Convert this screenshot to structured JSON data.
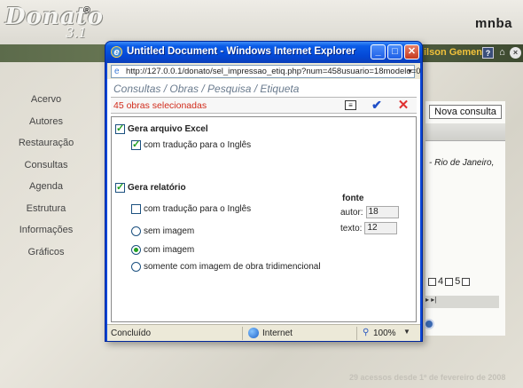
{
  "app": {
    "logo": "Donato",
    "logo_version": "3.1",
    "logo_reg": "®",
    "brand": "mnba",
    "user": "ilson Gemente",
    "footer": "29 acessos desde 1º de fevereiro de 2008"
  },
  "nav": {
    "items": [
      {
        "label": "Acervo"
      },
      {
        "label": "Autores"
      },
      {
        "label": "Restauração"
      },
      {
        "label": "Consultas"
      },
      {
        "label": "Agenda"
      },
      {
        "label": "Estrutura"
      },
      {
        "label": "Informações"
      },
      {
        "label": "Gráficos"
      }
    ]
  },
  "background_content": {
    "new_query_label": "Nova consulta",
    "partial_text": "- Rio de Janeiro,",
    "pager_4": "4",
    "pager_5": "5",
    "nav_arrows": "▸ ▸|"
  },
  "window": {
    "title": "Untitled Document - Windows Internet Explorer",
    "url": "http://127.0.0.1/donato/sel_impressao_etiq.php?num=458usuario=18modelo=0",
    "status": "Concluído",
    "zone": "Internet",
    "zoom": "100%"
  },
  "form": {
    "title": "Consultas / Obras / Pesquisa / Etiqueta",
    "selected_count": "45 obras selecionadas",
    "excel_label": "Gera arquivo Excel",
    "excel_translate_label": "com tradução para o Inglês",
    "report_label": "Gera relatório",
    "report_translate_label": "com tradução para o Inglês",
    "radio_no_image": "sem imagem",
    "radio_with_image": "com imagem",
    "radio_3d_only": "somente com imagem de obra tridimencional",
    "font_label": "fonte",
    "author_font_label": "autor:",
    "author_font_value": "18",
    "text_font_label": "texto:",
    "text_font_value": "12"
  },
  "icons": {
    "window": "ie-icon",
    "list": "list-icon",
    "confirm": "confirm-check-icon",
    "cancel": "cancel-x-icon",
    "zone": "globe-icon",
    "zoom": "magnifier-icon"
  },
  "colors": {
    "title_bar": "#0a5ce8",
    "selected_count": "#d12b1b",
    "checked": "#21a121",
    "user_name": "#f2c23b"
  }
}
